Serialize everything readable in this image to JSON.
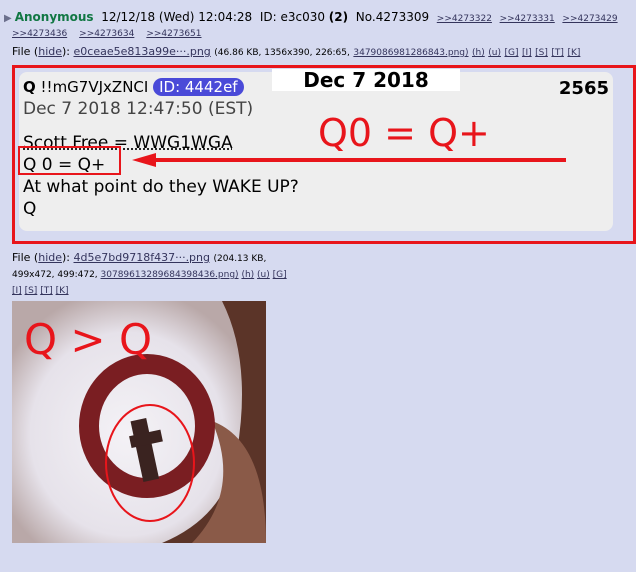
{
  "post": {
    "triangle": "▶",
    "name": "Anonymous",
    "datetime": "12/12/18 (Wed) 12:04:28",
    "id_label": "ID: e3c030",
    "id_count": "(2)",
    "number": "No.4273309",
    "backlinks": [
      ">>4273322",
      ">>4273331",
      ">>4273429",
      ">>4273436",
      ">>4273634",
      ">>4273651"
    ]
  },
  "file1": {
    "label": "File",
    "hide": "hide",
    "filename": "e0ceae5e813a99e···.png",
    "meta": "(46.86 KB, 1356x390, 226:65,",
    "original": "3479086981286843.png)",
    "links": [
      "(h)",
      "(u)",
      "[G]",
      "[I]",
      "[S]",
      "[T]",
      "[K]"
    ]
  },
  "card1": {
    "q": "Q",
    "trip": "!!mG7VJxZNCI",
    "id": "ID: 4442ef",
    "date_overlay": "Dec 7 2018",
    "number": "2565",
    "posted": "Dec 7 2018 12:47:50 (EST)",
    "lines": [
      "Scott Free = WWG1WGA",
      "Q 0 = Q+",
      "At what point do they WAKE UP?",
      "Q"
    ],
    "annotation": "Q0 = Q+",
    "accent": "#e8151b"
  },
  "file2": {
    "label": "File",
    "hide": "hide",
    "filename": "4d5e7bd9718f437···.png",
    "meta1": "(204.13 KB,",
    "meta2": "499x472, 499:472,",
    "original": "30789613289684398436.png)",
    "links": [
      "(h)",
      "(u)",
      "[G]"
    ],
    "links2": [
      "[I]",
      "[S]",
      "[T]",
      "[K]"
    ]
  },
  "image2": {
    "annotation": "Q > Q",
    "letter": "Q"
  }
}
